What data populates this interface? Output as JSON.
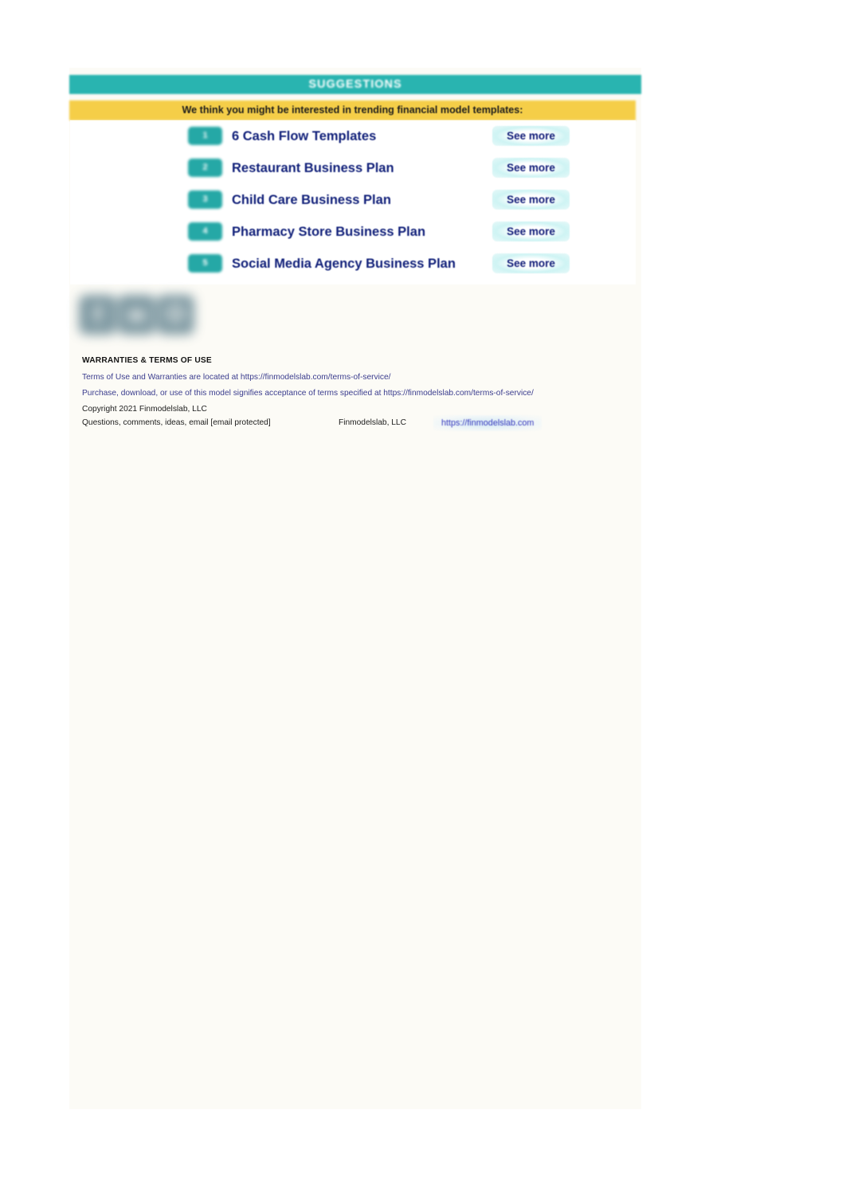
{
  "banner": {
    "title": "SUGGESTIONS",
    "intro": "We think you might be interested in trending financial model templates:",
    "header_color": "#29b4b0",
    "intro_band_color": "#f5ce48"
  },
  "suggestions": {
    "cta_label": "See more",
    "items": [
      {
        "number": "1",
        "title": "6 Cash Flow Templates",
        "cta": "See more"
      },
      {
        "number": "2",
        "title": "Restaurant Business Plan",
        "cta": "See more"
      },
      {
        "number": "3",
        "title": "Child Care Business Plan",
        "cta": "See more"
      },
      {
        "number": "4",
        "title": "Pharmacy Store Business Plan",
        "cta": "See more"
      },
      {
        "number": "5",
        "title": "Social Media Agency Business Plan",
        "cta": "See more"
      }
    ]
  },
  "social": {
    "icons": [
      {
        "name": "facebook-icon",
        "glyph": "f"
      },
      {
        "name": "twitter-icon",
        "glyph": "✉"
      },
      {
        "name": "instagram-icon",
        "glyph": ""
      }
    ]
  },
  "terms": {
    "heading": "WARRANTIES & TERMS OF USE",
    "line_1": "Terms of Use and Warranties are located at https://finmodelslab.com/terms-of-service/",
    "line_2": "Purchase, download, or use of this model signifies acceptance of terms specified at https://finmodelslab.com/terms-of-service/",
    "copyright": "Copyright 2021 Finmodelslab, LLC"
  },
  "contact": {
    "email_line": "Questions, comments, ideas, email [email protected]",
    "company": "Finmodelslab, LLC",
    "website": "https://finmodelslab.com"
  }
}
